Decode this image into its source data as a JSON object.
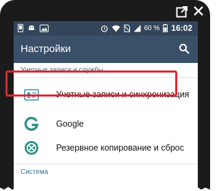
{
  "statusbar": {
    "battery_percent": "60 %",
    "time": "16:02",
    "icons": [
      "phone-icon",
      "android-debug-icon",
      "image-icon",
      "alarm-icon",
      "wifi-icon",
      "no-sim-icon",
      "signal-icon",
      "battery-icon"
    ]
  },
  "appbar": {
    "title": "Настройки"
  },
  "sections": [
    {
      "header": "Учетные записи и службы",
      "items": [
        {
          "label": "Учетные записи и синхронизация",
          "icon": "accounts-icon",
          "highlighted": true
        },
        {
          "label": "Google",
          "icon": "google-icon"
        },
        {
          "label": "Резервное копирование и сброс",
          "icon": "backup-icon"
        }
      ]
    },
    {
      "header": "Система"
    }
  ],
  "colors": {
    "frame": "#1b1b1b",
    "statusbar": "#33455a",
    "appbar": "#3a5069",
    "section_header": "#2f6e8c",
    "highlight": "#e3242b",
    "accent": "#2e8f86"
  }
}
